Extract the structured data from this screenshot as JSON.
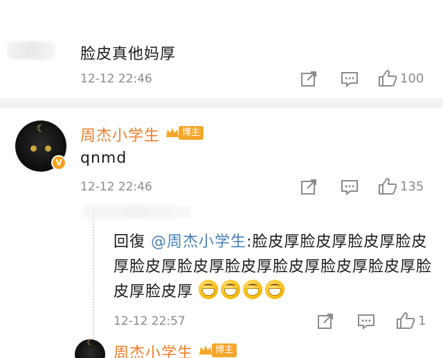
{
  "comments": [
    {
      "author": "",
      "text": "脸皮真他妈厚",
      "time": "12-12 22:46",
      "likes": "100"
    },
    {
      "author": "周杰小学生",
      "author_tag": "博主",
      "text": "qnmd",
      "time": "12-12 22:46",
      "likes": "135",
      "avatar_badge": "V",
      "replies": [
        {
          "prefix": "回復 ",
          "mention": "@周杰小学生",
          "text": ":脸皮厚脸皮厚脸皮厚脸皮厚脸皮厚脸皮厚脸皮厚脸皮厚脸皮厚脸皮厚脸皮厚脸皮厚",
          "emoji_count": 4,
          "emoji_name": "grin-emoji",
          "time": "12-12 22:57",
          "likes": "1"
        }
      ]
    },
    {
      "author": "周杰小学生",
      "author_tag": "博主"
    }
  ],
  "icons": {
    "share": "share-icon",
    "comment": "comment-icon",
    "like": "thumbs-up-icon"
  },
  "colors": {
    "username": "#f07c2a",
    "mention": "#4a7fb8",
    "tag": "#f4a62a",
    "meta": "#8a8a8a"
  }
}
